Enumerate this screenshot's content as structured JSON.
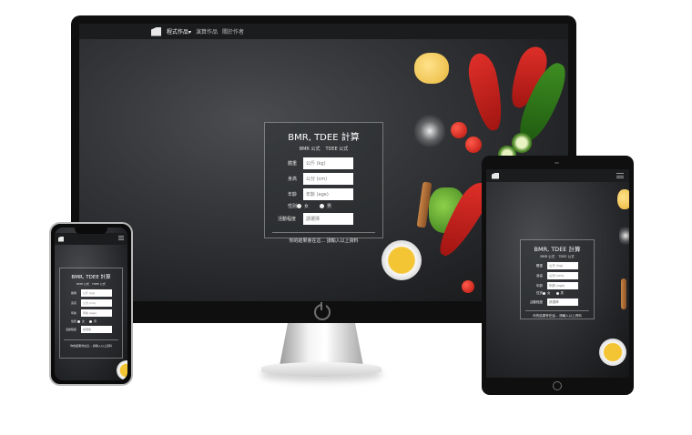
{
  "nav": {
    "items": [
      "程式作品",
      "演算作品",
      "關於作者"
    ],
    "active_caret": "▾"
  },
  "calculator": {
    "title": "BMR, TDEE 計算",
    "tabs": [
      "BMR 公式",
      "TDEE 公式"
    ],
    "fields": [
      {
        "label": "體重",
        "placeholder": "公斤 (kg)"
      },
      {
        "label": "身高",
        "placeholder": "公分 (cm)"
      },
      {
        "label": "年齡",
        "placeholder": "年齡 (age)"
      }
    ],
    "gender_label": "性別",
    "gender_options": [
      "女",
      "男"
    ],
    "activity_label": "活動程度",
    "activity_placeholder": "請選擇",
    "result_text": "你的結果會在這... 請輸入以上資料"
  },
  "colors": {
    "screen_dark": "#2d2f32",
    "navbar": "#1b1c1e",
    "device_body": "#0f0f10",
    "accent_red": "#d82a22",
    "accent_yellow": "#f3c433"
  }
}
